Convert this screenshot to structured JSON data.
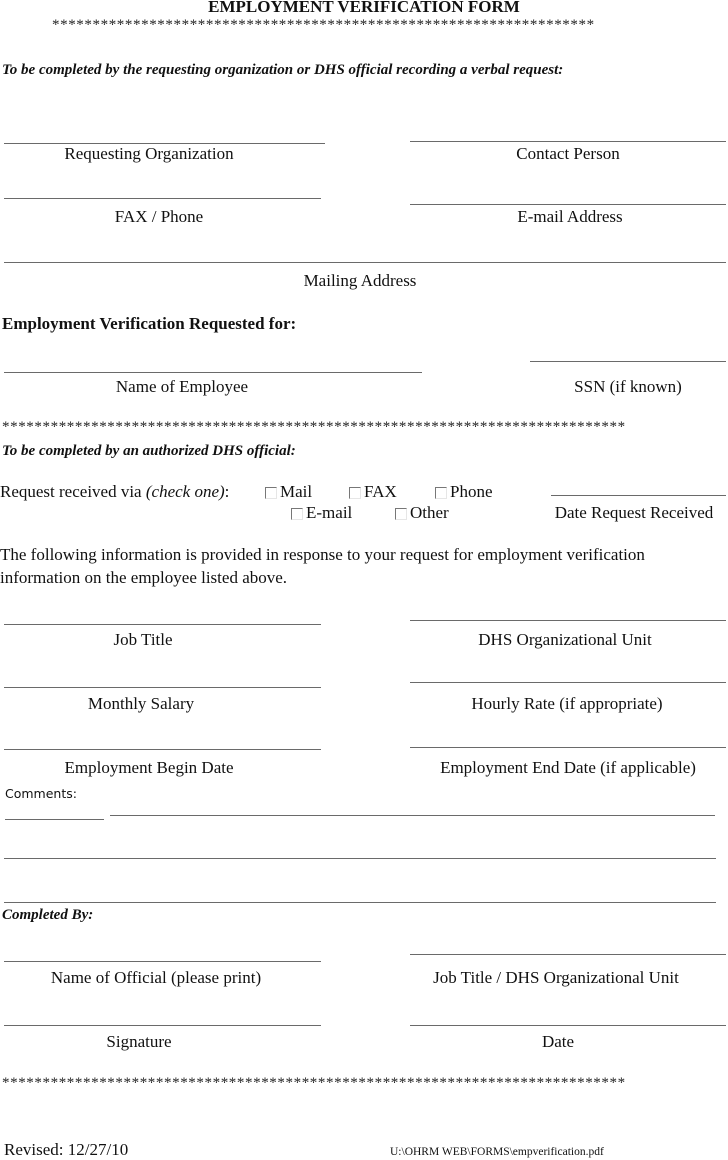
{
  "title": "EMPLOYMENT VERIFICATION FORM",
  "separator_short": "*******************************************************************",
  "separator_long": "*****************************************************************************",
  "section1": {
    "instruction": "To be completed by the requesting organization or DHS official recording a verbal request:",
    "fields": {
      "requesting_org": "Requesting Organization",
      "contact_person": "Contact Person",
      "fax_phone": "FAX / Phone",
      "email_address": "E-mail Address",
      "mailing_address": "Mailing Address"
    }
  },
  "section2": {
    "heading": "Employment Verification Requested for:",
    "fields": {
      "employee_name": "Name of Employee",
      "ssn": "SSN (if known)"
    }
  },
  "section3": {
    "instruction": "To be completed by an authorized DHS official:",
    "request_via_label": "Request received via ",
    "request_via_hint": "(check one)",
    "request_via_colon": ":",
    "options": [
      {
        "label": "Mail",
        "checked": false
      },
      {
        "label": "FAX",
        "checked": false
      },
      {
        "label": "Phone",
        "checked": false
      },
      {
        "label": "E-mail",
        "checked": false
      },
      {
        "label": "Other",
        "checked": false
      }
    ],
    "date_received": "Date Request Received",
    "info_text_line1": "The following information is provided in response to your request for employment verification",
    "info_text_line2": "information on the employee listed above.",
    "fields": {
      "job_title": "Job Title",
      "dhs_unit": "DHS Organizational Unit",
      "monthly_salary": "Monthly Salary",
      "hourly_rate": "Hourly Rate (if appropriate)",
      "begin_date": "Employment Begin Date",
      "end_date": "Employment End Date (if applicable)"
    },
    "comments_label": "Comments:"
  },
  "section4": {
    "heading": "Completed By:",
    "fields": {
      "official_name": "Name of Official (please print)",
      "official_title": "Job Title / DHS Organizational Unit",
      "signature": "Signature",
      "date": "Date"
    }
  },
  "footer": {
    "revised": "Revised:  12/27/10",
    "path": "U:\\OHRM WEB\\FORMS\\empverification.pdf"
  }
}
